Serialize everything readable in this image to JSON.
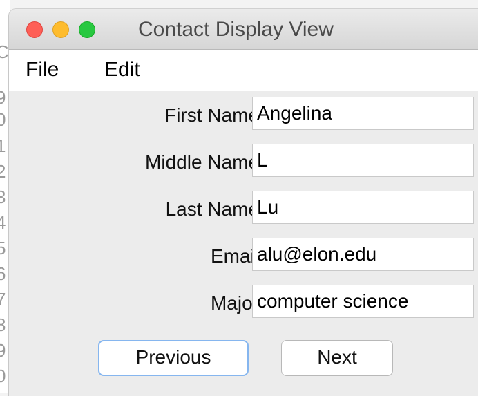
{
  "window": {
    "title": "Contact Display View"
  },
  "menubar": {
    "items": [
      "File",
      "Edit"
    ]
  },
  "form": {
    "fields": [
      {
        "label": "First Name",
        "value": "Angelina"
      },
      {
        "label": "Middle Name",
        "value": "L"
      },
      {
        "label": "Last Name",
        "value": "Lu"
      },
      {
        "label": "Email",
        "value": "alu@elon.edu"
      },
      {
        "label": "Major",
        "value": "computer science"
      }
    ]
  },
  "buttons": {
    "previous": "Previous",
    "next": "Next"
  },
  "background": {
    "glyphs": [
      "C",
      "9",
      "0",
      "1",
      "2",
      "3",
      "4",
      "5",
      "6",
      "7",
      "8",
      "9",
      "0"
    ]
  },
  "colors": {
    "close": "#fe5f57",
    "minimize": "#febc2e",
    "maximize": "#28c840",
    "focus_ring": "#86b6ef"
  }
}
